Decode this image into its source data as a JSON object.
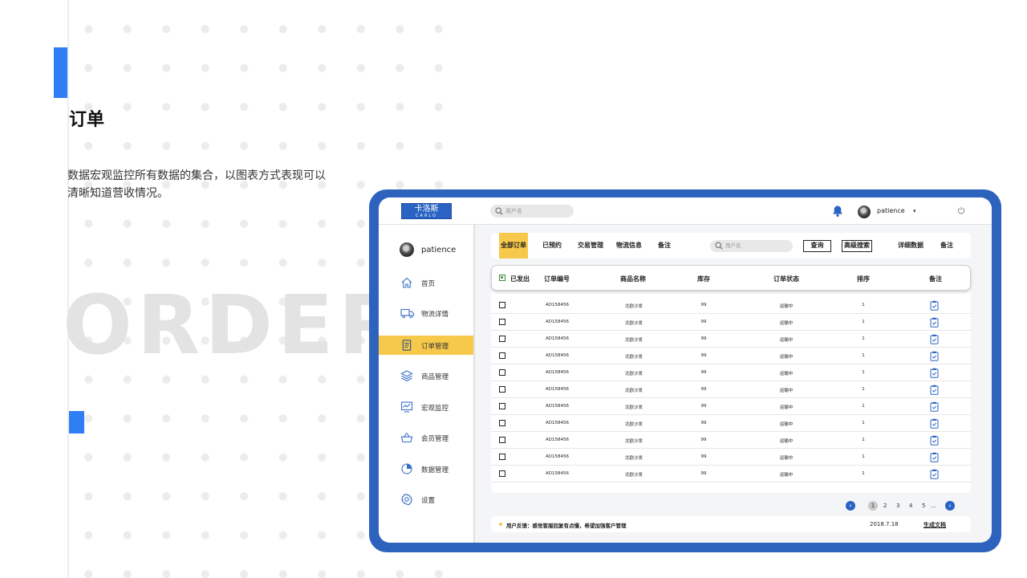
{
  "slide": {
    "title": "订单",
    "description": "数据宏观监控所有数据的集合，以图表方式表现可以清晰知道营收情况。",
    "background_word": "ORDER",
    "accent_color": "#2f7ef4"
  },
  "app": {
    "logo": {
      "name": "卡洛斯",
      "sub": "CARLO"
    },
    "search": {
      "placeholder": "用户名"
    },
    "user": {
      "name": "patience"
    },
    "colors": {
      "frame": "#2d62bd",
      "active": "#f6c94a",
      "brand": "#2a63c4"
    }
  },
  "sidebar": {
    "user": "patience",
    "items": [
      {
        "label": "首页",
        "icon": "home-icon",
        "active": false
      },
      {
        "label": "物流详情",
        "icon": "truck-icon",
        "active": false
      },
      {
        "label": "订单管理",
        "icon": "document-icon",
        "active": true
      },
      {
        "label": "商品管理",
        "icon": "layers-icon",
        "active": false
      },
      {
        "label": "宏观监控",
        "icon": "monitor-icon",
        "active": false
      },
      {
        "label": "会员管理",
        "icon": "basket-icon",
        "active": false
      },
      {
        "label": "数据管理",
        "icon": "pie-chart-icon",
        "active": false
      },
      {
        "label": "设置",
        "icon": "gear-icon",
        "active": false
      }
    ]
  },
  "filters": {
    "tabs": [
      "全部订单",
      "已预约",
      "交易管理",
      "物流信息",
      "备注"
    ],
    "search_placeholder": "用户名",
    "query_button": "查询",
    "advanced_button": "高级搜索",
    "detail_link": "详细数据",
    "note_link": "备注"
  },
  "table": {
    "select_label": "已发出",
    "columns": [
      "订单编号",
      "商品名称",
      "库存",
      "订单状态",
      "排序",
      "备注"
    ],
    "rows": [
      {
        "order_no": "AD158456",
        "product": "北欧沙发",
        "stock": "99",
        "status": "运输中",
        "sort": "1"
      },
      {
        "order_no": "AD158456",
        "product": "北欧沙发",
        "stock": "99",
        "status": "运输中",
        "sort": "1"
      },
      {
        "order_no": "AD158456",
        "product": "北欧沙发",
        "stock": "99",
        "status": "运输中",
        "sort": "1"
      },
      {
        "order_no": "AD158456",
        "product": "北欧沙发",
        "stock": "99",
        "status": "运输中",
        "sort": "1"
      },
      {
        "order_no": "AD158456",
        "product": "北欧沙发",
        "stock": "99",
        "status": "运输中",
        "sort": "1"
      },
      {
        "order_no": "AD158456",
        "product": "北欧沙发",
        "stock": "99",
        "status": "运输中",
        "sort": "1"
      },
      {
        "order_no": "AD158456",
        "product": "北欧沙发",
        "stock": "99",
        "status": "运输中",
        "sort": "1"
      },
      {
        "order_no": "AD158456",
        "product": "北欧沙发",
        "stock": "99",
        "status": "运输中",
        "sort": "1"
      },
      {
        "order_no": "AD158456",
        "product": "北欧沙发",
        "stock": "99",
        "status": "运输中",
        "sort": "1"
      },
      {
        "order_no": "AD158456",
        "product": "北欧沙发",
        "stock": "99",
        "status": "运输中",
        "sort": "1"
      },
      {
        "order_no": "AD158456",
        "product": "北欧沙发",
        "stock": "99",
        "status": "运输中",
        "sort": "1"
      }
    ]
  },
  "pagination": {
    "prev": "‹",
    "pages": [
      "1",
      "2",
      "3",
      "4",
      "5"
    ],
    "current": "1",
    "ellipsis": "…",
    "next": "›"
  },
  "footer": {
    "feedback": "用户反馈：感觉客服回复有点慢，希望加强客户管理",
    "date": "2018.7.18",
    "generate_link": "生成文档"
  }
}
